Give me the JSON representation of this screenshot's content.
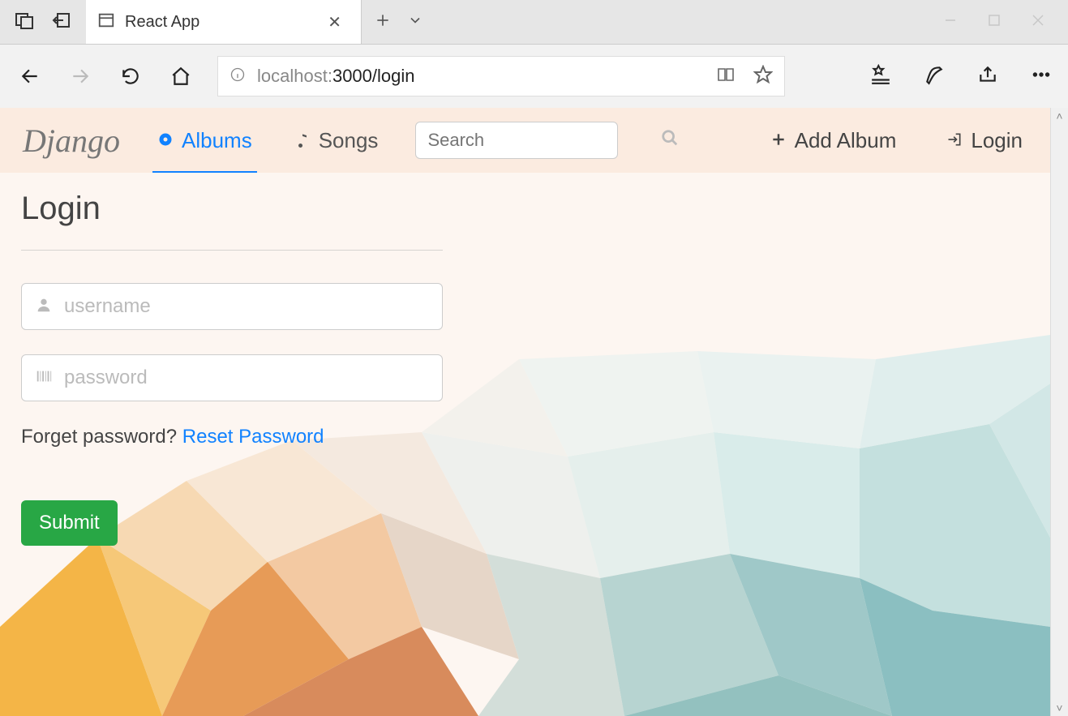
{
  "browser": {
    "tab_title": "React App",
    "url_host": "localhost:",
    "url_path": "3000/login"
  },
  "nav": {
    "brand": "Django",
    "albums": "Albums",
    "songs": "Songs",
    "search_placeholder": "Search",
    "add_album": "Add Album",
    "login": "Login"
  },
  "page": {
    "title": "Login",
    "username_placeholder": "username",
    "password_placeholder": "password",
    "forgot_text": "Forget password? ",
    "reset_link": "Reset Password",
    "submit": "Submit"
  }
}
